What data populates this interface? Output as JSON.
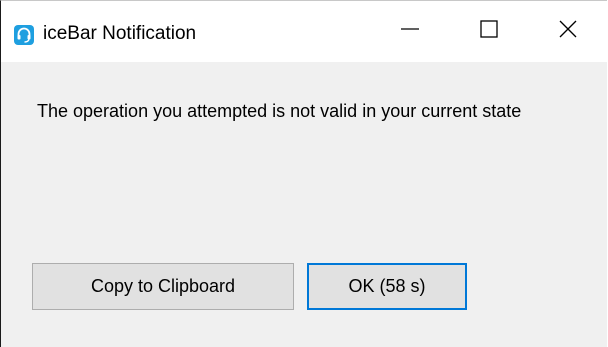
{
  "window": {
    "title": "iceBar Notification",
    "app_icon": "headset-icon",
    "controls": {
      "minimize_icon": "minimize-icon",
      "maximize_icon": "maximize-icon",
      "close_icon": "close-icon"
    }
  },
  "dialog": {
    "message": "The operation you attempted is not valid in your current state",
    "copy_button_label": "Copy to Clipboard",
    "ok_button_label": "OK (58 s)"
  },
  "colors": {
    "accent": "#0078d7",
    "icon_bg": "#1e9fe0",
    "body_bg": "#f0f0f0",
    "button_bg": "#e1e1e1"
  }
}
